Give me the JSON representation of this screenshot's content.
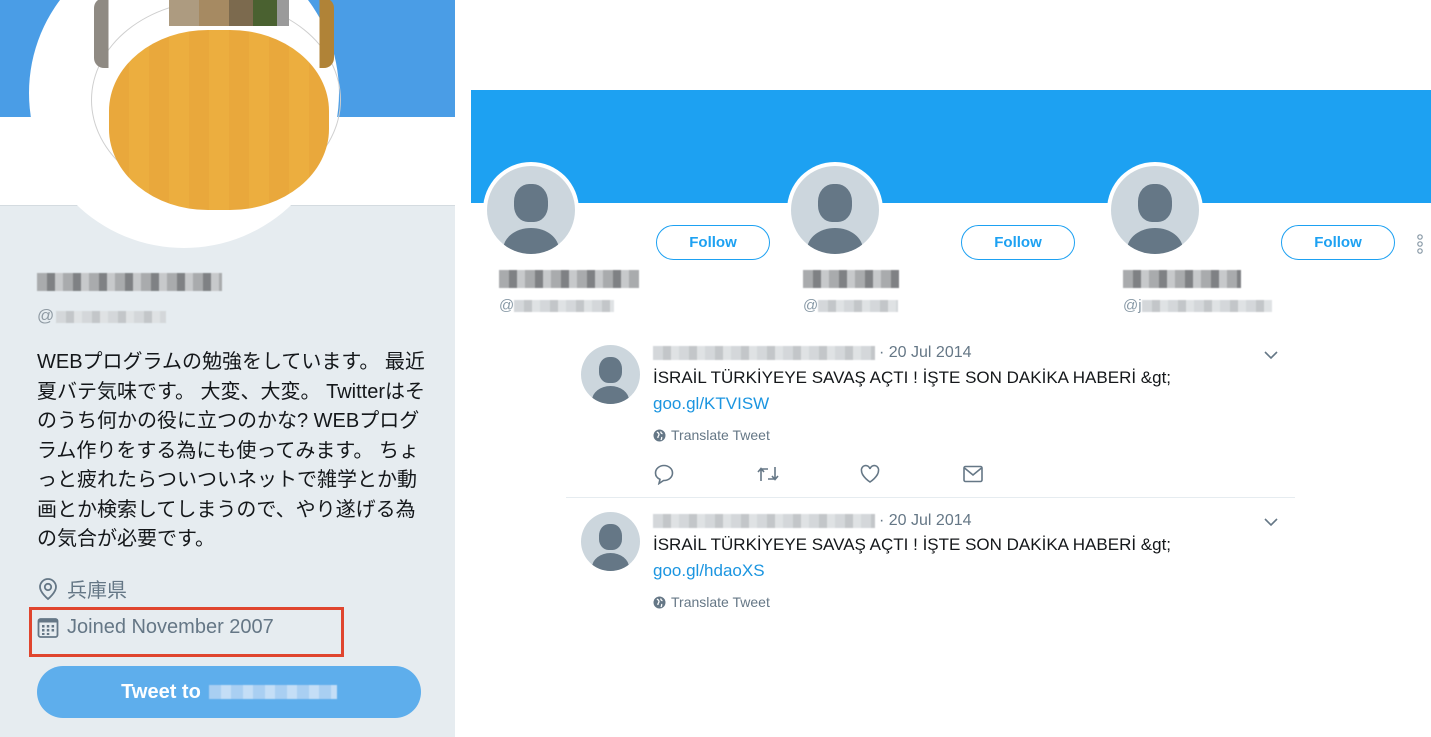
{
  "profile": {
    "name_redacted": true,
    "handle_prefix": "@",
    "bio": "WEBプログラムの勉強をしています。 最近夏バテ気味です。 大変、大変。 Twitterはそのうち何かの役に立つのかな? WEBプログラム作りをする為にも使ってみます。 ちょっと疲れたらついついネットで雑学とか動画とか検索してしまうので、やり遂げる為の気合が必要です。",
    "location": "兵庫県",
    "joined": "Joined November 2007",
    "tweet_to_label": "Tweet to",
    "location_icon": "location-pin-icon",
    "calendar_icon": "calendar-icon",
    "highlight_color": "#e0452e"
  },
  "suggested_users": [
    {
      "handle_prefix": "@",
      "follow_label": "Follow"
    },
    {
      "handle_prefix": "@",
      "follow_label": "Follow"
    },
    {
      "handle_prefix": "@j",
      "follow_label": "Follow"
    }
  ],
  "tweets": [
    {
      "date": "· 20 Jul 2014",
      "text": "İSRAİL TÜRKİYEYE SAVAŞ AÇTI ! İŞTE SON DAKİKA HABERİ &gt;",
      "link": "goo.gl/KTVISW",
      "translate_label": "Translate Tweet",
      "actions": [
        "reply-icon",
        "retweet-icon",
        "like-icon",
        "message-icon"
      ]
    },
    {
      "date": "· 20 Jul 2014",
      "text": "İSRAİL TÜRKİYEYE SAVAŞ AÇTI ! İŞTE SON DAKİKA HABERİ &gt;",
      "link": "goo.gl/hdaoXS",
      "translate_label": "Translate Tweet"
    }
  ],
  "colors": {
    "brand_blue": "#1da1f2",
    "left_banner": "#4a9de6",
    "link": "#1b95e0",
    "tweet_button": "#5eaeec"
  }
}
